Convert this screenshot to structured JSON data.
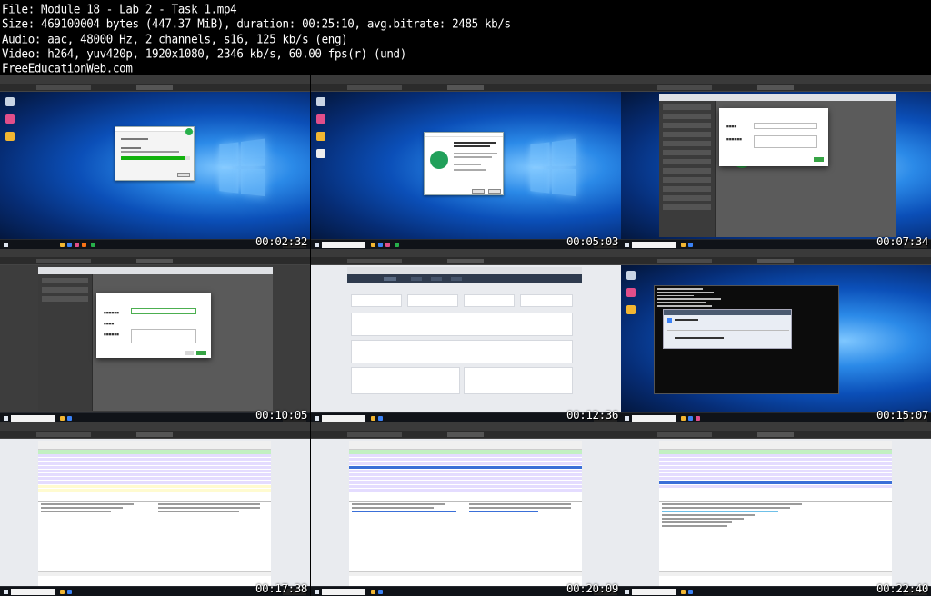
{
  "file_info": [
    "File: Module 18 - Lab 2 - Task 1.mp4",
    "Size: 469100004 bytes (447.37 MiB), duration: 00:25:10, avg.bitrate: 2485 kb/s",
    "Audio: aac, 48000 Hz, 2 channels, s16, 125 kb/s (eng)",
    "Video: h264, yuv420p, 1920x1080, 2346 kb/s, 60.00 fps(r) (und)",
    "FreeEducationWeb.com"
  ],
  "thumbnails": [
    {
      "timestamp": "00:02:32",
      "scene": "desktop-installer-progress"
    },
    {
      "timestamp": "00:05:03",
      "scene": "desktop-setup-wizard"
    },
    {
      "timestamp": "00:07:34",
      "scene": "iot-create-network-modal"
    },
    {
      "timestamp": "00:10:05",
      "scene": "iot-create-device-modal"
    },
    {
      "timestamp": "00:12:36",
      "scene": "iot-dashboard"
    },
    {
      "timestamp": "00:15:07",
      "scene": "desktop-terminal-notification"
    },
    {
      "timestamp": "00:17:38",
      "scene": "wireshark-capture"
    },
    {
      "timestamp": "00:20:09",
      "scene": "wireshark-selected-packet"
    },
    {
      "timestamp": "00:22:40",
      "scene": "wireshark-packet-details"
    }
  ],
  "colors": {
    "background": "#000000",
    "text": "#ffffff",
    "progress_green": "#12b20d",
    "create_button": "#37a445",
    "wireshark_filter": "#c2f0c2"
  }
}
